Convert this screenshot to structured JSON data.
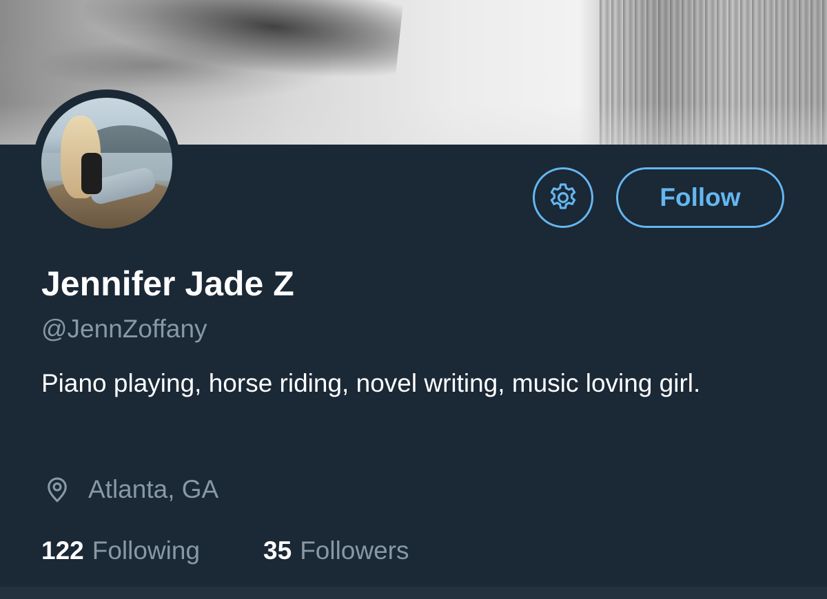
{
  "profile": {
    "name": "Jennifer Jade Z",
    "handle": "@JennZoffany",
    "bio": "Piano playing, horse riding, novel writing, music loving girl.",
    "location": "Atlanta, GA"
  },
  "actions": {
    "follow_label": "Follow",
    "settings_icon": "gear-icon"
  },
  "stats": {
    "following_count": "122",
    "following_label": "Following",
    "followers_count": "35",
    "followers_label": "Followers"
  },
  "icons": {
    "location": "map-pin-icon"
  },
  "colors": {
    "background": "#1b2836",
    "accent": "#64b7f0",
    "primary_text": "#ffffff",
    "secondary_text": "#8899a6"
  }
}
